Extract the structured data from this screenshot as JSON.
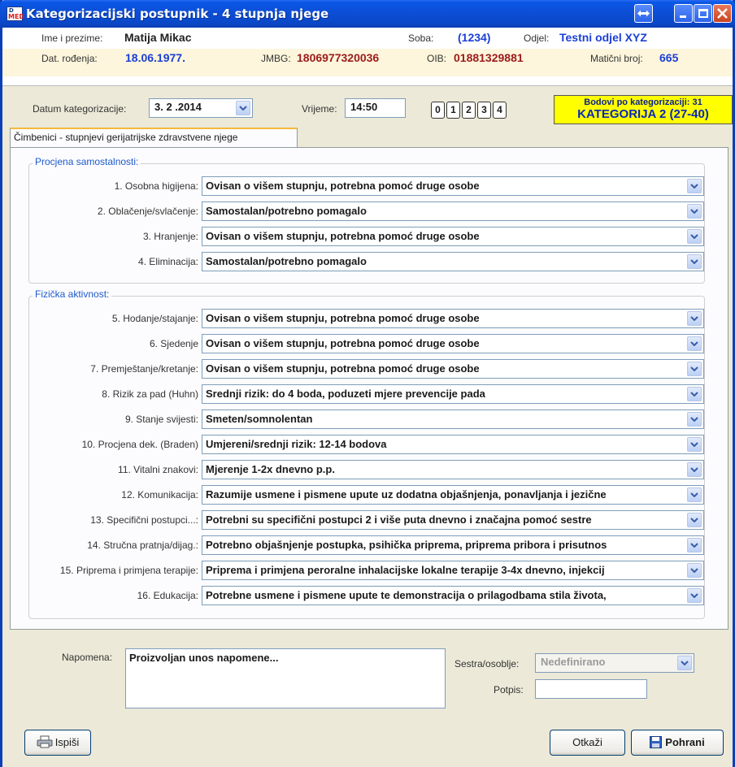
{
  "window": {
    "title": "Kategorizacijski postupnik - 4 stupnja njege"
  },
  "patient": {
    "name_label": "Ime i prezime:",
    "name": "Matija Mikac",
    "room_label": "Soba:",
    "room": "(1234)",
    "dept_label": "Odjel:",
    "dept": "Testni odjel XYZ",
    "dob_label": "Dat. rođenja:",
    "dob": "18.06.1977.",
    "jmbg_label": "JMBG:",
    "jmbg": "1806977320036",
    "oib_label": "OIB:",
    "oib": "01881329881",
    "mbr_label": "Matični broj:",
    "mbr": "665"
  },
  "categorization": {
    "date_label": "Datum kategorizacije:",
    "date": "3. 2 .2014",
    "time_label": "Vrijeme:",
    "time": "14:50",
    "number_buttons": [
      "0",
      "1",
      "2",
      "3",
      "4"
    ],
    "points_text": "Bodovi po kategorizaciji: 31",
    "category_text": "KATEGORIJA 2 (27-40)",
    "category_bg": "#ffff00"
  },
  "tab": {
    "label": "Čimbenici - stupnjevi gerijatrijske zdravstvene njege"
  },
  "group1": {
    "title": "Procjena samostalnosti:",
    "items": [
      {
        "label": "1. Osobna higijena:",
        "value": "Ovisan o višem stupnju, potrebna pomoć druge osobe"
      },
      {
        "label": "2. Oblačenje/svlačenje:",
        "value": "Samostalan/potrebno pomagalo"
      },
      {
        "label": "3. Hranjenje:",
        "value": "Ovisan o višem stupnju, potrebna pomoć druge osobe"
      },
      {
        "label": "4. Eliminacija:",
        "value": "Samostalan/potrebno pomagalo"
      }
    ]
  },
  "group2": {
    "title": "Fizička aktivnost:",
    "items": [
      {
        "label": "5. Hodanje/stajanje:",
        "value": "Ovisan o višem stupnju, potrebna pomoć druge osobe"
      },
      {
        "label": "6. Sjedenje",
        "value": "Ovisan o višem stupnju, potrebna pomoć druge osobe"
      },
      {
        "label": "7. Premještanje/kretanje:",
        "value": "Ovisan o višem stupnju, potrebna pomoć druge osobe"
      },
      {
        "label": "8. Rizik za pad (Huhn)",
        "value": "Srednji rizik: do 4 boda, poduzeti mjere prevencije pada"
      },
      {
        "label": "9. Stanje svijesti:",
        "value": "Smeten/somnolentan"
      },
      {
        "label": "10. Procjena dek. (Braden)",
        "value": "Umjereni/srednji rizik: 12-14 bodova"
      },
      {
        "label": "11. Vitalni znakovi:",
        "value": "Mjerenje 1-2x dnevno p.p."
      },
      {
        "label": "12. Komunikacija:",
        "value": "Razumije usmene i pismene upute uz dodatna objašnjenja, ponavljanja i jezične"
      },
      {
        "label": "13. Specifični postupci...:",
        "value": "Potrebni su specifični postupci 2 i više puta dnevno i značajna pomoć sestre"
      },
      {
        "label": "14. Stručna pratnja/dijag.:",
        "value": "Potrebno objašnjenje postupka, psihička priprema, priprema pribora i prisutnos"
      },
      {
        "label": "15. Priprema i primjena terapije:",
        "value": "Priprema i primjena peroralne inhalacijske lokalne terapije 3-4x dnevno, injekcij"
      },
      {
        "label": "16. Edukacija:",
        "value": "Potrebne usmene i pismene upute te demonstracija o prilagodbama stila života,"
      }
    ]
  },
  "notes": {
    "label": "Napomena:",
    "value": "Proizvoljan unos napomene...",
    "staff_label": "Sestra/osoblje:",
    "staff_value": "Nedefinirano",
    "signature_label": "Potpis:"
  },
  "buttons": {
    "print": "Ispiši",
    "cancel": "Otkaži",
    "save": "Pohrani"
  }
}
